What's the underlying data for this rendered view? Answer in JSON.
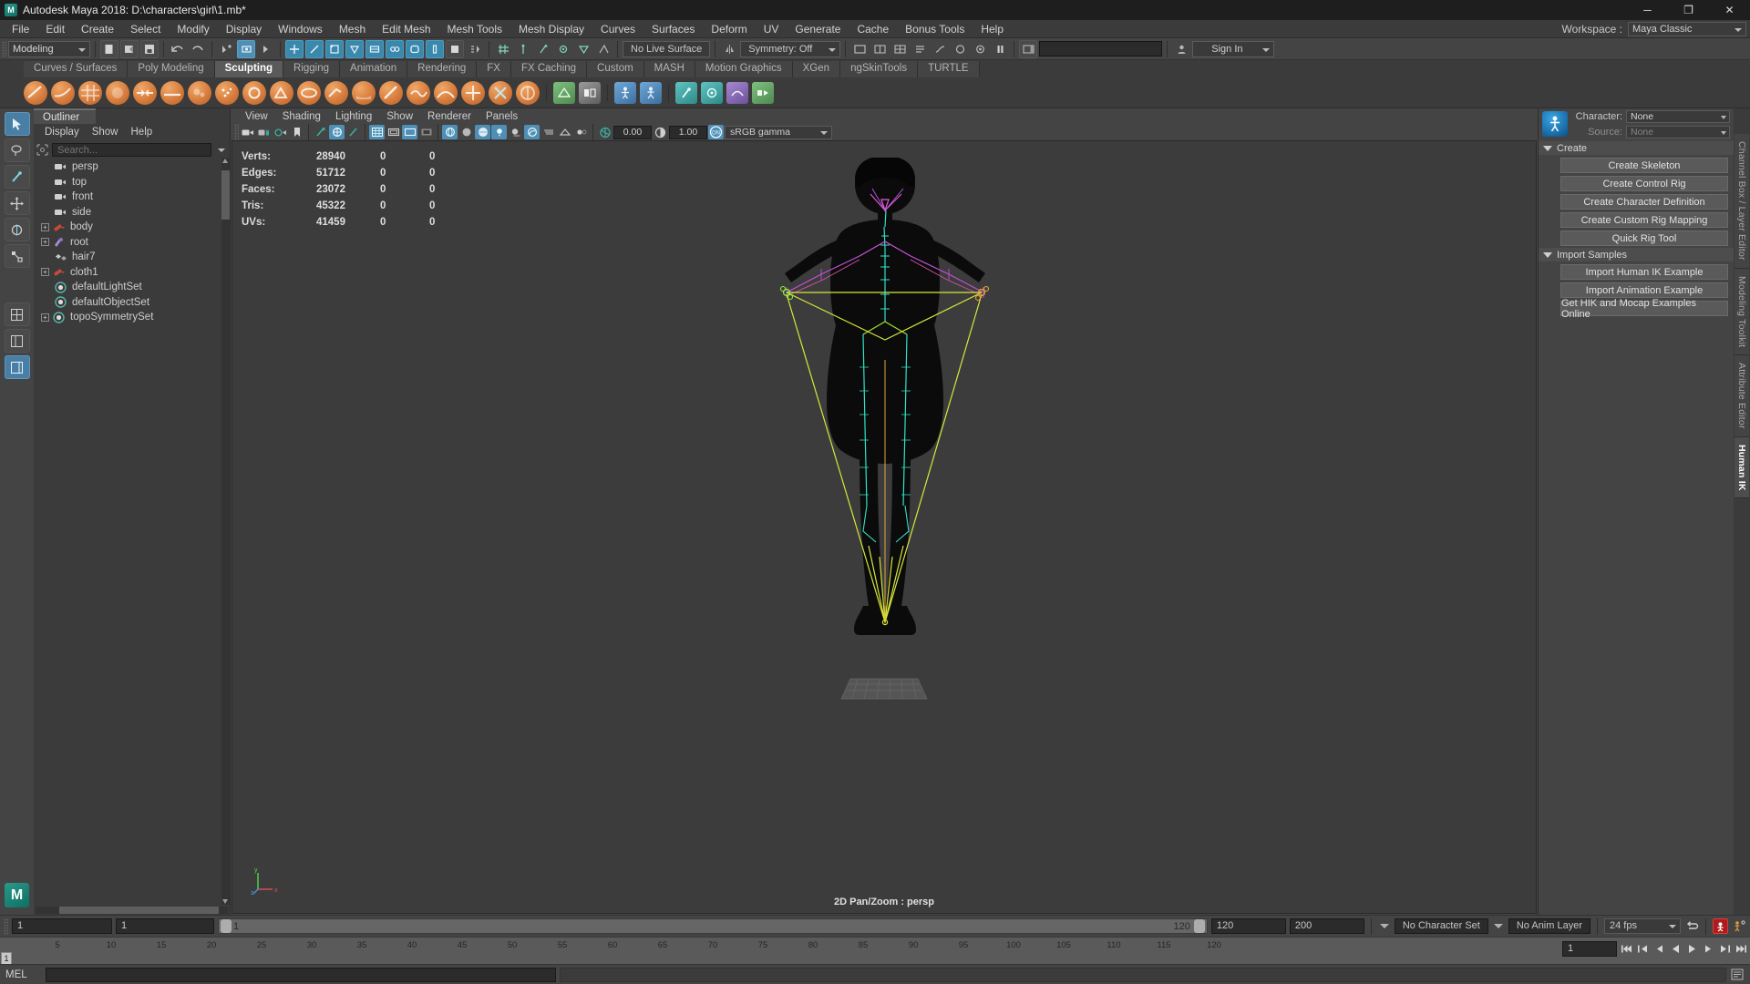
{
  "titlebar": {
    "title": "Autodesk Maya 2018: D:\\characters\\girl\\1.mb*",
    "logo_icon": "maya-logo-icon",
    "minimize_icon": "minimize-icon",
    "maximize_icon": "maximize-icon",
    "close_icon": "close-icon",
    "minimize": "─",
    "maximize": "❐",
    "close": "✕"
  },
  "menubar": {
    "items": [
      "File",
      "Edit",
      "Create",
      "Select",
      "Modify",
      "Display",
      "Windows",
      "Mesh",
      "Edit Mesh",
      "Mesh Tools",
      "Mesh Display",
      "Curves",
      "Surfaces",
      "Deform",
      "UV",
      "Generate",
      "Cache",
      "Bonus Tools",
      "Help"
    ],
    "workspace_label": "Workspace :",
    "workspace_value": "Maya Classic"
  },
  "statusbar": {
    "mode": "Modeling",
    "no_live_surface": "No Live Surface",
    "symmetry": "Symmetry: Off",
    "sign_in": "Sign In",
    "search_placeholder": ""
  },
  "shelf": {
    "tabs": [
      {
        "label": "Curves / Surfaces",
        "active": false
      },
      {
        "label": "Poly Modeling",
        "active": false
      },
      {
        "label": "Sculpting",
        "active": true
      },
      {
        "label": "Rigging",
        "active": false
      },
      {
        "label": "Animation",
        "active": false
      },
      {
        "label": "Rendering",
        "active": false
      },
      {
        "label": "FX",
        "active": false
      },
      {
        "label": "FX Caching",
        "active": false
      },
      {
        "label": "Custom",
        "active": false
      },
      {
        "label": "MASH",
        "active": false
      },
      {
        "label": "Motion Graphics",
        "active": false
      },
      {
        "label": "XGen",
        "active": false
      },
      {
        "label": "ngSkinTools",
        "active": false
      },
      {
        "label": "TURTLE",
        "active": false
      }
    ]
  },
  "outliner": {
    "tab": "Outliner",
    "menu": [
      "Display",
      "Show",
      "Help"
    ],
    "search_placeholder": "Search...",
    "search_value": "",
    "items": [
      {
        "label": "persp",
        "icon": "camera-icon",
        "expandable": false,
        "indent": 1
      },
      {
        "label": "top",
        "icon": "camera-icon",
        "expandable": false,
        "indent": 1
      },
      {
        "label": "front",
        "icon": "camera-icon",
        "expandable": false,
        "indent": 1
      },
      {
        "label": "side",
        "icon": "camera-icon",
        "expandable": false,
        "indent": 1
      },
      {
        "label": "body",
        "icon": "mesh-icon",
        "expandable": true,
        "indent": 0
      },
      {
        "label": "root",
        "icon": "joint-icon",
        "expandable": true,
        "indent": 0
      },
      {
        "label": "hair7",
        "icon": "polymesh-icon",
        "expandable": false,
        "indent": 1
      },
      {
        "label": "cloth1",
        "icon": "mesh-icon",
        "expandable": true,
        "indent": 0
      },
      {
        "label": "defaultLightSet",
        "icon": "set-icon",
        "expandable": false,
        "indent": 1
      },
      {
        "label": "defaultObjectSet",
        "icon": "set-icon",
        "expandable": false,
        "indent": 1
      },
      {
        "label": "topoSymmetrySet",
        "icon": "set-icon",
        "expandable": true,
        "indent": 0
      }
    ]
  },
  "viewport": {
    "menu": [
      "View",
      "Shading",
      "Lighting",
      "Show",
      "Renderer",
      "Panels"
    ],
    "exposure_value": "0.00",
    "gamma_value": "1.00",
    "color_profile": "sRGB gamma",
    "label": "2D Pan/Zoom : persp",
    "hud": {
      "rows": [
        {
          "key": "Verts:",
          "value": "28940",
          "col2": "0",
          "col3": "0"
        },
        {
          "key": "Edges:",
          "value": "51712",
          "col2": "0",
          "col3": "0"
        },
        {
          "key": "Faces:",
          "value": "23072",
          "col2": "0",
          "col3": "0"
        },
        {
          "key": "Tris:",
          "value": "45322",
          "col2": "0",
          "col3": "0"
        },
        {
          "key": "UVs:",
          "value": "41459",
          "col2": "0",
          "col3": "0"
        }
      ]
    },
    "axis": {
      "x": "x",
      "y": "y",
      "z": "z"
    }
  },
  "humanik": {
    "logo_icon": "humanik-logo-icon",
    "character_label": "Character:",
    "character_value": "None",
    "source_label": "Source:",
    "source_value": "None",
    "sections": [
      {
        "title": "Create",
        "buttons": [
          "Create Skeleton",
          "Create Control Rig",
          "Create Character Definition",
          "Create Custom Rig Mapping",
          "Quick Rig Tool"
        ]
      },
      {
        "title": "Import Samples",
        "buttons": [
          "Import Human IK Example",
          "Import Animation Example",
          "Get HIK and Mocap Examples Online"
        ]
      }
    ]
  },
  "vertical_tabs": [
    {
      "label": "Channel Box / Layer Editor",
      "active": false
    },
    {
      "label": "Modeling Toolkit",
      "active": false
    },
    {
      "label": "Attribute Editor",
      "active": false
    },
    {
      "label": "Human IK",
      "active": true
    }
  ],
  "timecontrols": {
    "current_frame": "1",
    "start_field": "1",
    "range_start": "1",
    "range_end": "120",
    "playback_start": "120",
    "playback_end": "200",
    "character_set": "No Character Set",
    "anim_layer": "No Anim Layer",
    "fps": "24 fps",
    "loop_icon": "loop-icon",
    "auto_key_icon": "auto-key-icon",
    "anim_prefs_icon": "animation-preferences-icon"
  },
  "timeline": {
    "current_frame": "1",
    "frame_field": "1",
    "ticks": [
      "5",
      "10",
      "15",
      "20",
      "25",
      "30",
      "35",
      "40",
      "45",
      "50",
      "55",
      "60",
      "65",
      "70",
      "75",
      "80",
      "85",
      "90",
      "95",
      "100",
      "105",
      "110",
      "115",
      "120"
    ],
    "transport_icons": [
      "go-to-start-icon",
      "step-back-key-icon",
      "step-back-frame-icon",
      "play-backwards-icon",
      "play-forwards-icon",
      "step-forward-frame-icon",
      "step-forward-key-icon",
      "go-to-end-icon"
    ]
  },
  "commandline": {
    "label": "MEL",
    "input_value": "",
    "output_value": ""
  }
}
